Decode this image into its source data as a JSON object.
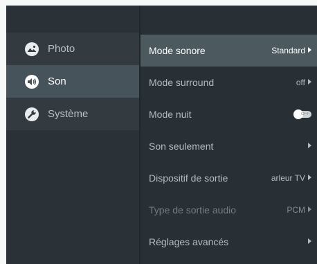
{
  "sidebar": {
    "items": [
      {
        "label": "Photo",
        "icon": "photo-icon",
        "selected": false
      },
      {
        "label": "Son",
        "icon": "speaker-icon",
        "selected": true
      },
      {
        "label": "Système",
        "icon": "wrench-icon",
        "selected": false
      }
    ]
  },
  "settings": {
    "items": [
      {
        "label": "Mode sonore",
        "value": "Standard",
        "control": "arrow",
        "selected": true,
        "enabled": true
      },
      {
        "label": "Mode surround",
        "value": "off",
        "control": "arrow",
        "selected": false,
        "enabled": true
      },
      {
        "label": "Mode nuit",
        "value": "OFF",
        "control": "toggle",
        "state": "off",
        "selected": false,
        "enabled": true
      },
      {
        "label": "Son seulement",
        "value": "",
        "control": "arrow",
        "selected": false,
        "enabled": true
      },
      {
        "label": "Dispositif de sortie",
        "value": "arleur TV",
        "control": "arrow",
        "selected": false,
        "enabled": true
      },
      {
        "label": "Type de sortie audio",
        "value": "PCM",
        "control": "arrow",
        "selected": false,
        "enabled": false
      },
      {
        "label": "Réglages avancés",
        "value": "",
        "control": "arrow",
        "selected": false,
        "enabled": true
      }
    ]
  },
  "colors": {
    "selected_row": "#4c595f",
    "sidebar_selected": "#47535a",
    "background": "#283035"
  }
}
